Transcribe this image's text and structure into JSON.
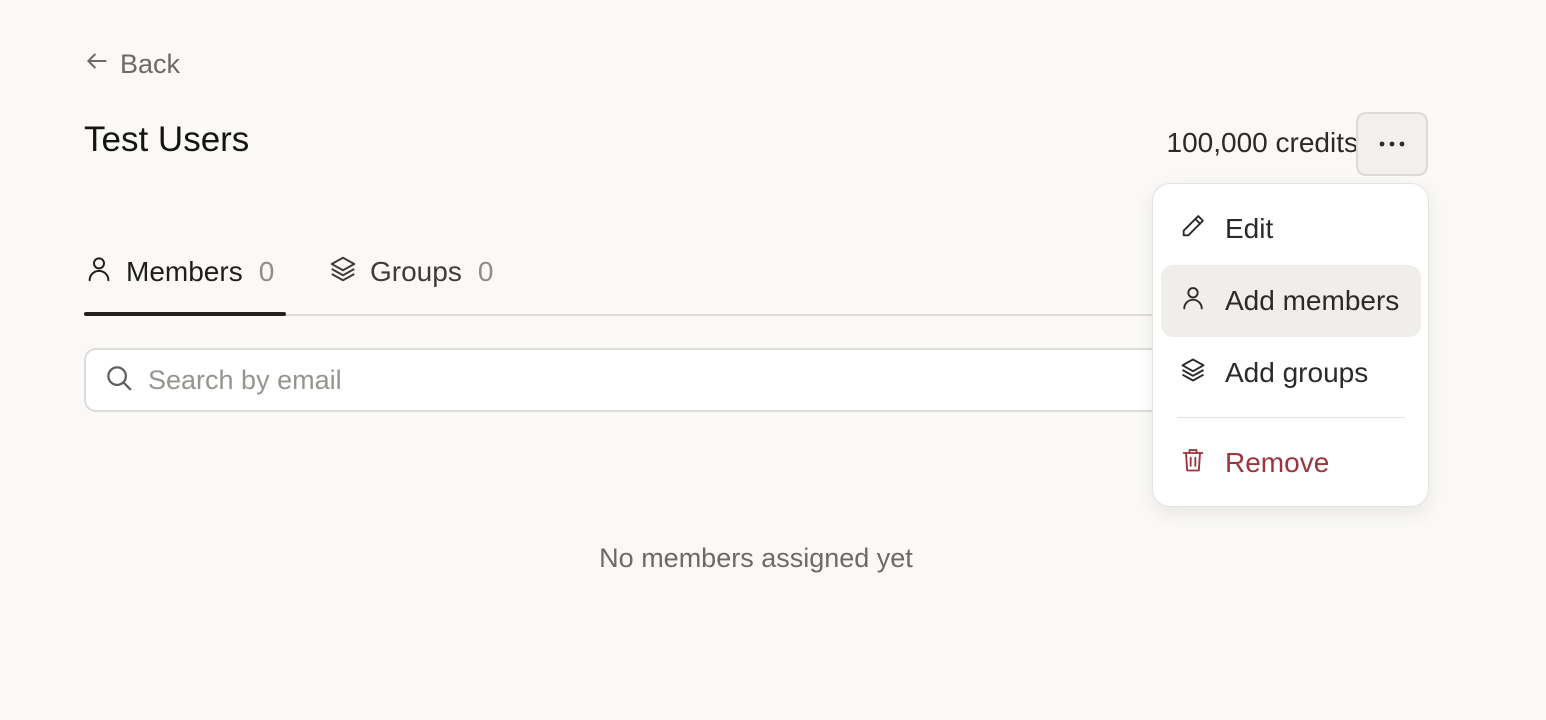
{
  "nav": {
    "back_label": "Back"
  },
  "header": {
    "title": "Test Users",
    "credits": "100,000 credits"
  },
  "tabs": [
    {
      "label": "Members",
      "count": "0",
      "active": true
    },
    {
      "label": "Groups",
      "count": "0",
      "active": false
    }
  ],
  "search": {
    "placeholder": "Search by email",
    "value": ""
  },
  "empty_state": "No members assigned yet",
  "menu": {
    "items": [
      {
        "label": "Edit",
        "icon": "pencil-icon"
      },
      {
        "label": "Add members",
        "icon": "user-icon",
        "highlighted": true
      },
      {
        "label": "Add groups",
        "icon": "layers-icon"
      },
      {
        "label": "Remove",
        "icon": "trash-icon",
        "destructive": true
      }
    ]
  },
  "colors": {
    "background": "#faf9f7",
    "destructive": "#9b3540",
    "active_tab_underline": "#24221f",
    "highlight": "#efeeea"
  }
}
